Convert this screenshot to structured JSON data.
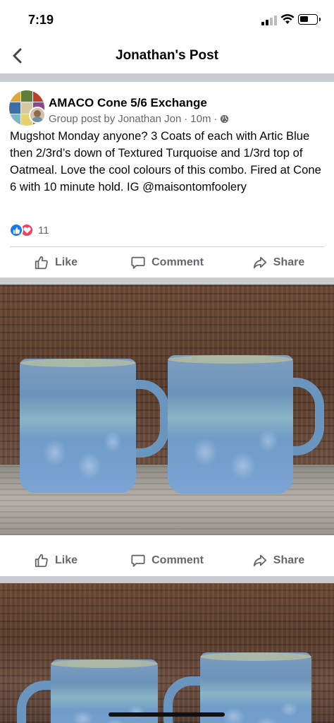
{
  "status_bar": {
    "time": "7:19"
  },
  "nav": {
    "title": "Jonathan's Post"
  },
  "post": {
    "group_name": "AMACO Cone 5/6 Exchange",
    "meta_prefix": "Group post by",
    "author": "Jonathan Jon",
    "separator": "·",
    "time_ago": "10m",
    "separator2": "·",
    "text": "Mugshot Monday anyone? 3 Coats of each with Artic Blue then 2/3rd’s down of Textured Turquoise and 1/3rd top of Oatmeal. Love the cool colours of this combo. Fired at Cone 6 with 10 minute hold. IG @maisontomfoolery",
    "reaction_count": "11"
  },
  "actions": {
    "like_label": "Like",
    "comment_label": "Comment",
    "share_label": "Share"
  },
  "icons": {
    "back": "chevron-left-icon",
    "globe": "globe-icon",
    "like": "thumbs-up-icon",
    "comment": "speech-bubble-icon",
    "share": "share-arrow-icon"
  },
  "colors": {
    "facebook_blue": "#1877f2",
    "love_red": "#f33e58",
    "secondary_text": "#65676b"
  }
}
